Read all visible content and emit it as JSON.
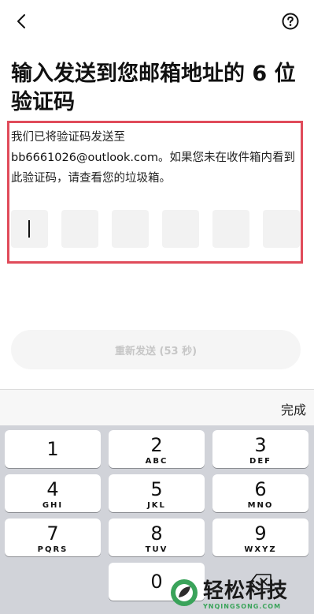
{
  "header": {
    "back_icon": "chevron-left-icon",
    "help_icon": "question-circle-icon"
  },
  "title": "输入发送到您邮箱地址的 6 位验证码",
  "description": {
    "line1": "我们已将验证码发送至",
    "email": "bb6661026@outlook.com",
    "line2": "。如果您未在收件箱内看到此验证码，请查看您的垃圾箱。"
  },
  "code_boxes": [
    "",
    "",
    "",
    "",
    "",
    ""
  ],
  "resend_button": "重新发送 (53 秒)",
  "keyboard_bar": {
    "done_label": "完成"
  },
  "keypad": [
    {
      "num": "1",
      "letters": ""
    },
    {
      "num": "2",
      "letters": "ABC"
    },
    {
      "num": "3",
      "letters": "DEF"
    },
    {
      "num": "4",
      "letters": "GHI"
    },
    {
      "num": "5",
      "letters": "JKL"
    },
    {
      "num": "6",
      "letters": "MNO"
    },
    {
      "num": "7",
      "letters": "PQRS"
    },
    {
      "num": "8",
      "letters": "TUV"
    },
    {
      "num": "9",
      "letters": "WXYZ"
    },
    {
      "num": "0",
      "letters": ""
    }
  ],
  "watermark": {
    "title": "轻松科技",
    "subtitle": "YNQINGSONG.COM"
  },
  "colors": {
    "highlight_border": "#e04b5a",
    "watermark_green": "#3aa35a"
  }
}
